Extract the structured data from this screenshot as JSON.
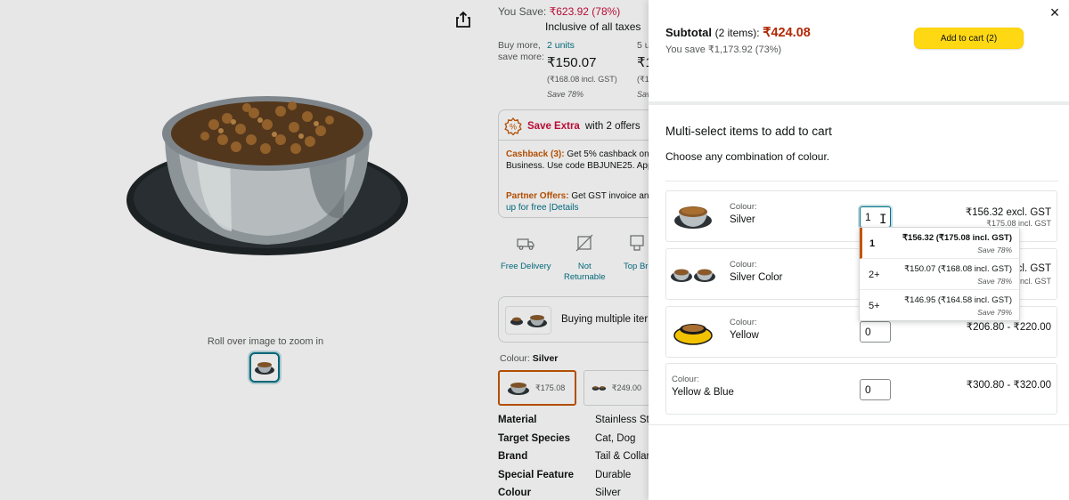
{
  "product_page": {
    "save_label": "You Save:",
    "save_value": "₹623.92 (78%)",
    "tax_note": "Inclusive of all taxes",
    "zoom_hint": "Roll over image to zoom in",
    "buy_more_label": "Buy more, save more:",
    "tiers": [
      {
        "units": "2 units",
        "price": "₹150.07",
        "incl": "(₹168.08 incl. GST)",
        "save": "Save 78%"
      },
      {
        "units": "5 u",
        "price": "₹1",
        "incl": "(₹1",
        "save": "Sav"
      }
    ],
    "offers": {
      "title_bold": "Save Extra",
      "title_rest": "with 2 offers",
      "cashback_title": "Cashback (3):",
      "cashback_line1": " Get 5% cashback on",
      "cashback_line2": "Business. Use code BBJUNE25. App",
      "partner_title": "Partner Offers:",
      "partner_line1": " Get GST invoice an",
      "partner_line2a": "up for free ",
      "partner_details": "|Details"
    },
    "features": [
      {
        "label1": "Free Delivery",
        "label2": "",
        "icon": "truck-icon"
      },
      {
        "label1": "Not",
        "label2": "Returnable",
        "icon": "no-return-icon"
      },
      {
        "label1": "Top Br",
        "label2": "",
        "icon": "top-brand-icon"
      }
    ],
    "buy_multiple": "Buying multiple iter",
    "colour_label": "Colour:",
    "colour_value": "Silver",
    "swatches": [
      {
        "price": "₹175.08"
      },
      {
        "price": "₹249.00"
      }
    ],
    "specs": [
      {
        "k": "Material",
        "v": "Stainless Ste"
      },
      {
        "k": "Target Species",
        "v": "Cat, Dog"
      },
      {
        "k": "Brand",
        "v": "Tail & Collar"
      },
      {
        "k": "Special Feature",
        "v": "Durable"
      },
      {
        "k": "Colour",
        "v": "Silver"
      }
    ]
  },
  "panel": {
    "close_icon": "×",
    "subtotal_label": "Subtotal",
    "subtotal_count": "(2 items):",
    "subtotal_amount": "₹424.08",
    "you_save": "You save ₹1,173.92 (73%)",
    "add_to_cart": "Add to cart (2)",
    "multi_title": "Multi-select items to add to cart",
    "multi_sub": "Choose any combination of colour.",
    "colour_key": "Colour:",
    "items": [
      {
        "colour": "Silver",
        "qty": "1",
        "price1": "₹156.32 excl. GST",
        "price2": "₹175.08 incl. GST"
      },
      {
        "colour": "Silver Color",
        "qty": "",
        "price1": "cl. GST",
        "price2": "ncl. GST"
      },
      {
        "colour": "Yellow",
        "qty": "0",
        "price1": "₹206.80 - ₹220.00",
        "price2": ""
      },
      {
        "colour": "Yellow & Blue",
        "qty": "0",
        "price1": "₹300.80 - ₹320.00",
        "price2": ""
      }
    ],
    "dropdown": [
      {
        "qty": "1",
        "price": "₹156.32 (₹175.08 incl. GST)",
        "save": "Save 78%"
      },
      {
        "qty": "2+",
        "price": "₹150.07 (₹168.08 incl. GST)",
        "save": "Save 78%"
      },
      {
        "qty": "5+",
        "price": "₹146.95 (₹164.58 incl. GST)",
        "save": "Save 79%"
      }
    ]
  },
  "colors": {
    "accent_orange": "#c45500",
    "price_red": "#b12704",
    "link_teal": "#007185",
    "cart_yellow": "#ffd814"
  }
}
